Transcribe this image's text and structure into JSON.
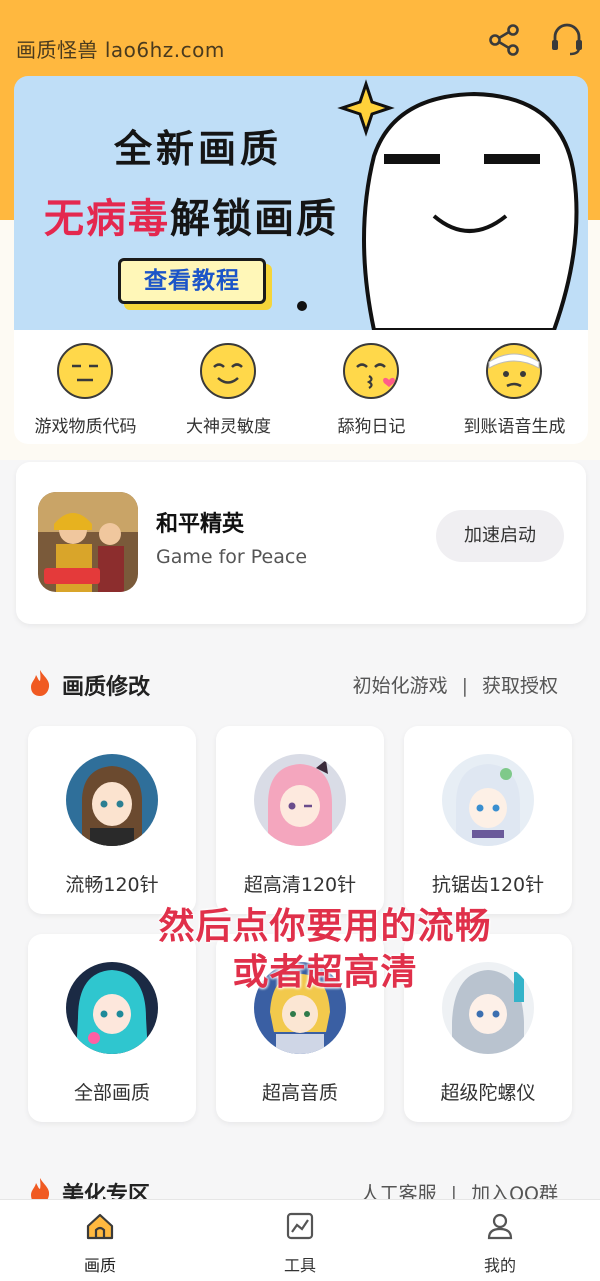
{
  "header": {
    "app_title": "画质怪兽 lao6hz.com",
    "share_icon": "share-icon",
    "support_icon": "headset-icon"
  },
  "banner": {
    "line1": "全新画质",
    "line2_red": "无病毒",
    "line2_dark": "解锁画质",
    "tutorial_button": "查看教程",
    "accent_color": "#e4284f"
  },
  "categories": [
    {
      "label": "游戏物质代码",
      "icon": "neutral-face-icon"
    },
    {
      "label": "大神灵敏度",
      "icon": "smiling-face-icon"
    },
    {
      "label": "舔狗日记",
      "icon": "kissing-face-icon"
    },
    {
      "label": "到账语音生成",
      "icon": "bandaged-face-icon"
    }
  ],
  "game": {
    "name": "和平精英",
    "subtitle": "Game for Peace",
    "action_button": "加速启动"
  },
  "section_quality": {
    "title": "画质修改",
    "link1": "初始化游戏",
    "separator": "|",
    "link2": "获取授权"
  },
  "modes": [
    {
      "label": "流畅120针"
    },
    {
      "label": "超高清120针"
    },
    {
      "label": "抗锯齿120针"
    },
    {
      "label": "全部画质"
    },
    {
      "label": "超高音质"
    },
    {
      "label": "超级陀螺仪"
    }
  ],
  "overlay_caption": {
    "line1": "然后点你要用的流畅",
    "line2": "或者超高清"
  },
  "section_beauty": {
    "title": "美化专区",
    "link1": "人工客服",
    "separator": "|",
    "link2": "加入QQ群"
  },
  "tabbar": [
    {
      "label": "画质",
      "icon": "home-icon",
      "active": true
    },
    {
      "label": "工具",
      "icon": "tools-icon",
      "active": false
    },
    {
      "label": "我的",
      "icon": "profile-icon",
      "active": false
    }
  ],
  "colors": {
    "header_bg": "#ffb83f",
    "banner_bg": "#bfdef7",
    "fire": "#f05a22"
  }
}
